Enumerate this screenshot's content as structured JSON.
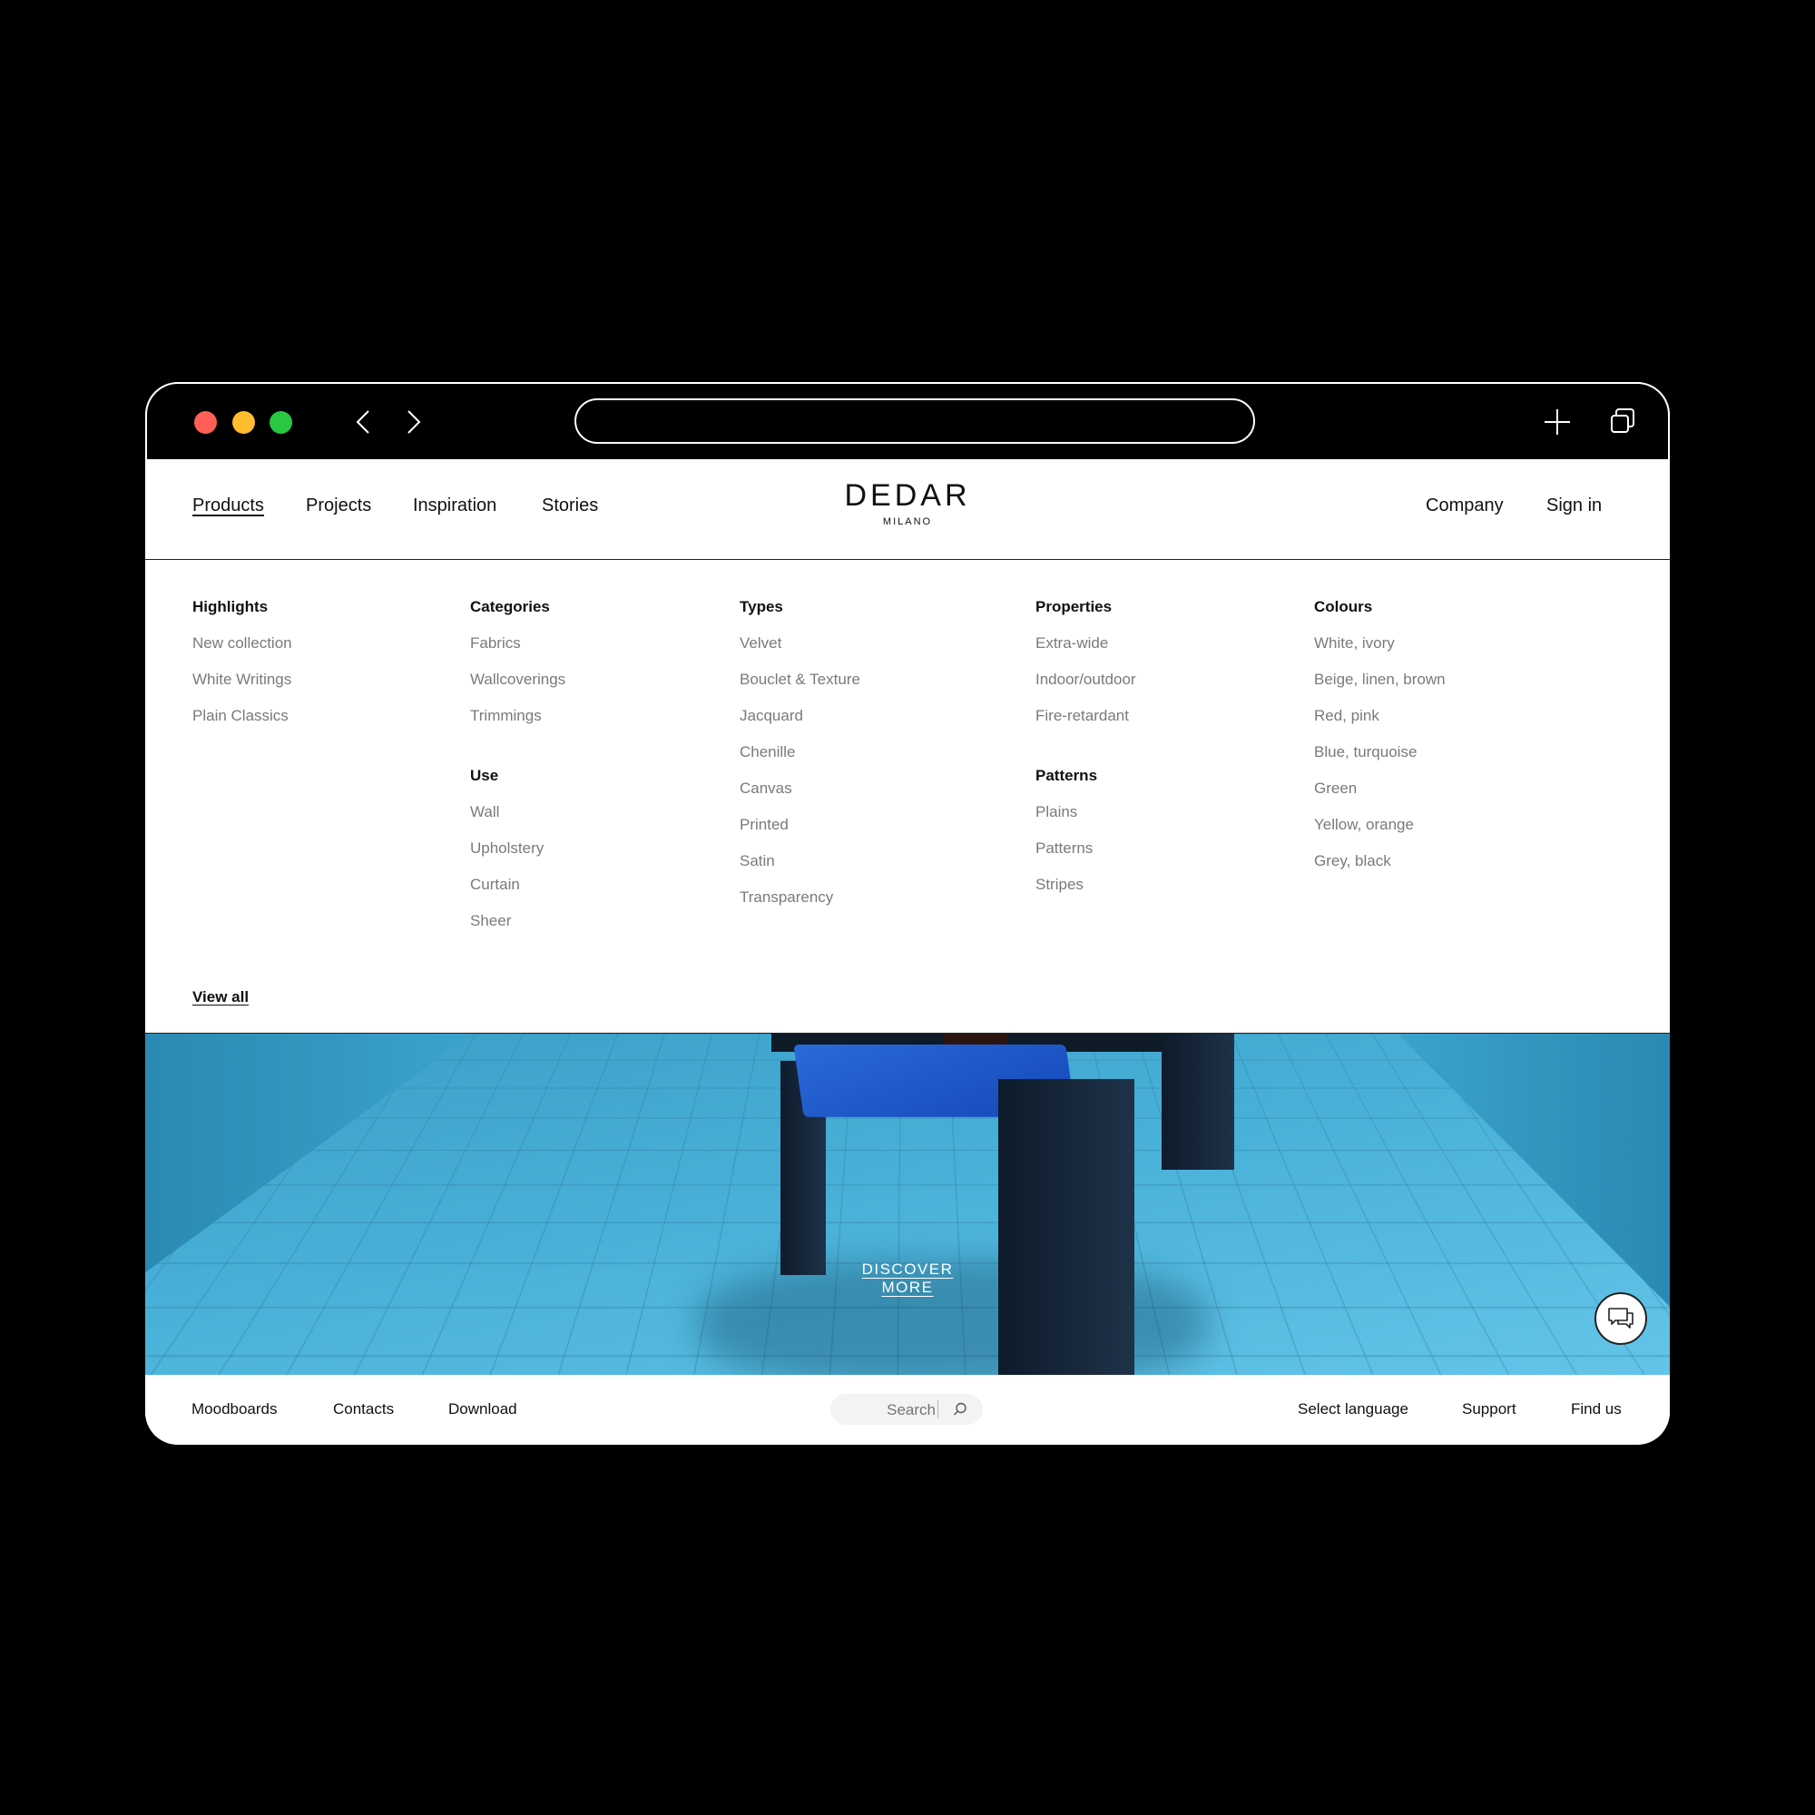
{
  "site": {
    "logo_main": "DEDAR",
    "logo_sub": "MILANO"
  },
  "header": {
    "nav_left": [
      "Products",
      "Projects",
      "Inspiration",
      "Stories"
    ],
    "active_nav": "Products",
    "nav_right": [
      "Company",
      "Sign in"
    ]
  },
  "menu": {
    "highlights": {
      "title": "Highlights",
      "items": [
        "New collection",
        "White Writings",
        "Plain Classics"
      ]
    },
    "categories": {
      "title": "Categories",
      "items": [
        "Fabrics",
        "Wallcoverings",
        "Trimmings"
      ]
    },
    "use": {
      "title": "Use",
      "items": [
        "Wall",
        "Upholstery",
        "Curtain",
        "Sheer"
      ]
    },
    "types": {
      "title": "Types",
      "items": [
        "Velvet",
        "Bouclet & Texture",
        "Jacquard",
        "Chenille",
        "Canvas",
        "Printed",
        "Satin",
        "Transparency"
      ]
    },
    "properties": {
      "title": "Properties",
      "items": [
        "Extra-wide",
        "Indoor/outdoor",
        "Fire-retardant"
      ]
    },
    "patterns": {
      "title": "Patterns",
      "items": [
        "Plains",
        "Patterns",
        "Stripes"
      ]
    },
    "colours": {
      "title": "Colours",
      "items": [
        "White, ivory",
        "Beige, linen, brown",
        "Red, pink",
        "Blue, turquoise",
        "Green",
        "Yellow, orange",
        "Grey, black"
      ]
    },
    "view_all": "View all"
  },
  "hero": {
    "cta": "DISCOVER MORE"
  },
  "footer": {
    "left": [
      "Moodboards",
      "Contacts",
      "Download"
    ],
    "search_placeholder": "Search",
    "right": [
      "Select language",
      "Support",
      "Find us"
    ]
  },
  "icons": {
    "back": "chevron-left-icon",
    "forward": "chevron-right-icon",
    "new_tab": "plus-icon",
    "tabs": "tabs-icon",
    "search": "search-icon",
    "chat": "chat-icon"
  },
  "colors": {
    "traffic_red": "#ff5f57",
    "traffic_yellow": "#febc2e",
    "traffic_green": "#28c840",
    "menu_item_grey": "#7a7a7a"
  }
}
